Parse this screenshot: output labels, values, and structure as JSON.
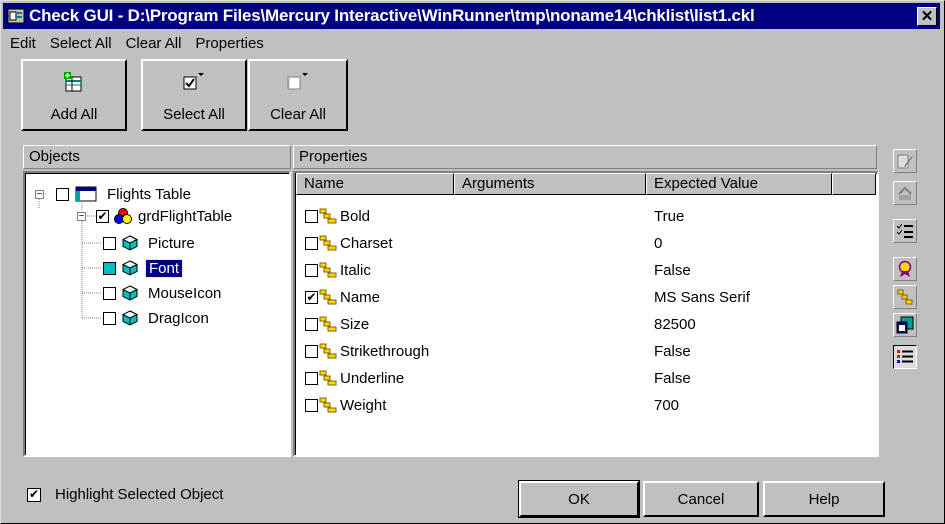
{
  "window": {
    "title": "Check GUI - D:\\Program Files\\Mercury Interactive\\WinRunner\\tmp\\noname14\\chklist\\list1.ckl",
    "close_glyph": "✕"
  },
  "menu": {
    "items": [
      "Edit",
      "Select All",
      "Clear All",
      "Properties"
    ]
  },
  "toolbar": {
    "add_all": "Add All",
    "select_all": "Select All",
    "clear_all": "Clear All"
  },
  "objects_panel": {
    "header": "Objects",
    "tree": [
      {
        "label": "Flights Table",
        "checked": false
      },
      {
        "label": "grdFlightTable",
        "checked": true
      },
      {
        "label": "Picture",
        "checked": false
      },
      {
        "label": "Font",
        "checked": false,
        "selected": true
      },
      {
        "label": "MouseIcon",
        "checked": false
      },
      {
        "label": "DragIcon",
        "checked": false
      }
    ]
  },
  "properties_panel": {
    "header": "Properties",
    "columns": [
      "Name",
      "Arguments",
      "Expected Value"
    ],
    "rows": [
      {
        "name": "Bold",
        "arguments": "",
        "expected": "True",
        "checked": false
      },
      {
        "name": "Charset",
        "arguments": "",
        "expected": "0",
        "checked": false
      },
      {
        "name": "Italic",
        "arguments": "",
        "expected": "False",
        "checked": false
      },
      {
        "name": "Name",
        "arguments": "",
        "expected": "MS Sans Serif",
        "checked": true
      },
      {
        "name": "Size",
        "arguments": "",
        "expected": "82500",
        "checked": false
      },
      {
        "name": "Strikethrough",
        "arguments": "",
        "expected": "False",
        "checked": false
      },
      {
        "name": "Underline",
        "arguments": "",
        "expected": "False",
        "checked": false
      },
      {
        "name": "Weight",
        "arguments": "",
        "expected": "700",
        "checked": false
      }
    ]
  },
  "footer": {
    "highlight_label": "Highlight Selected Object",
    "highlight_checked": true,
    "ok": "OK",
    "cancel": "Cancel",
    "help": "Help"
  },
  "colors": {
    "titlebar": "#000080",
    "selection": "#000080",
    "selected_checkbox": "#00c0c0"
  }
}
